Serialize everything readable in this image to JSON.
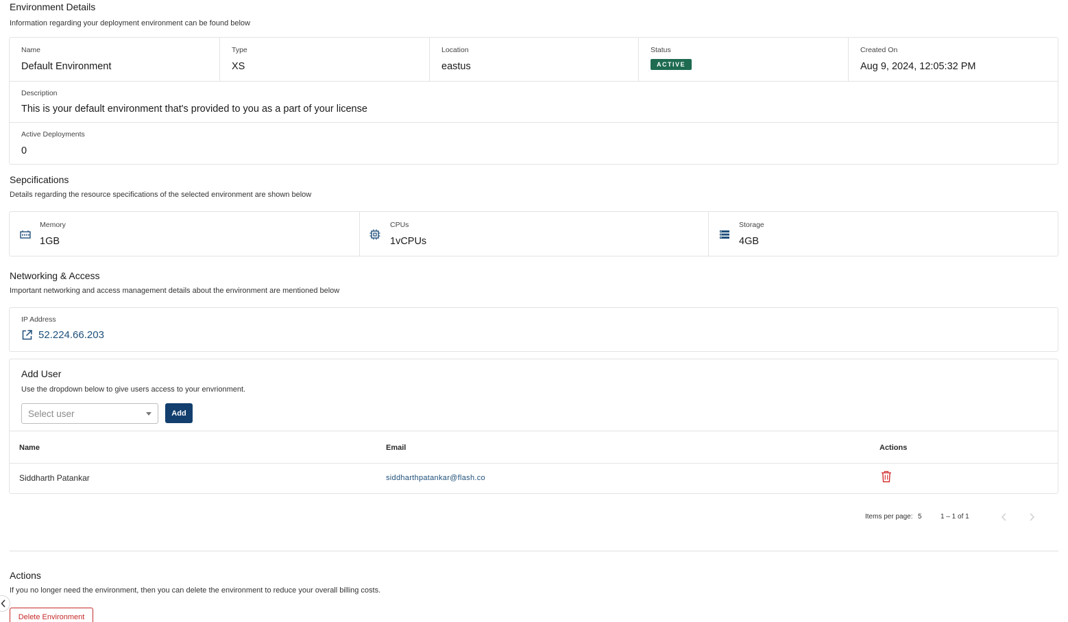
{
  "environment": {
    "title": "Environment Details",
    "subtitle": "Information regarding your deployment environment can be found below",
    "fields": {
      "name_label": "Name",
      "name_value": "Default Environment",
      "type_label": "Type",
      "type_value": "XS",
      "location_label": "Location",
      "location_value": "eastus",
      "status_label": "Status",
      "status_value": "ACTIVE",
      "created_label": "Created On",
      "created_value": "Aug 9, 2024, 12:05:32 PM"
    },
    "description_label": "Description",
    "description_value": "This is your default environment that's provided to you as a part of your license",
    "active_deployments_label": "Active Deployments",
    "active_deployments_value": "0",
    "status_color": "#1e6b52"
  },
  "specifications": {
    "title": "Sepcifications",
    "subtitle": "Details regarding the resource specifications of the selected environment are shown below",
    "items": [
      {
        "icon": "memory-icon",
        "label": "Memory",
        "value": "1GB"
      },
      {
        "icon": "cpu-icon",
        "label": "CPUs",
        "value": "1vCPUs"
      },
      {
        "icon": "storage-icon",
        "label": "Storage",
        "value": "4GB"
      }
    ]
  },
  "networking": {
    "title": "Networking & Access",
    "subtitle": "Important networking and access management details about the environment are mentioned below",
    "ip_label": "IP Address",
    "ip_value": "52.224.66.203",
    "ip_icon": "external-link-icon"
  },
  "add_user": {
    "title": "Add User",
    "subtitle": "Use the dropdown below to give users access to your envrionment.",
    "select_placeholder": "Select user",
    "add_button": "Add",
    "button_color": "#123f6e"
  },
  "users_table": {
    "columns": [
      "Name",
      "Email",
      "Actions"
    ],
    "rows": [
      {
        "name": "Siddharth Patankar",
        "email": "siddharthpatankar@flash.co",
        "action_icon": "trash-icon"
      }
    ]
  },
  "paginator": {
    "items_per_page_label": "Items per page:",
    "items_per_page_value": "5",
    "range": "1 – 1 of 1"
  },
  "actions": {
    "title": "Actions",
    "subtitle": "If you no longer need the environment, then you can delete the environment to reduce your overall billing costs.",
    "delete_button": "Delete Environment",
    "danger_color": "#c62828"
  }
}
